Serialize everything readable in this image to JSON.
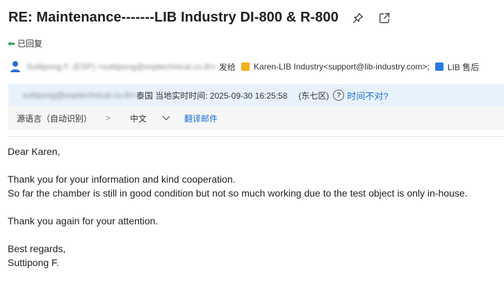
{
  "header": {
    "subject": "RE: Maintenance-------LIB Industry DI-800 & R-800",
    "pin_icon": "pin-icon",
    "popout_icon": "external-open-icon"
  },
  "status": {
    "replied": "已回复"
  },
  "from": {
    "sender_blurred": "Suttipong F. (ESP) <suttipong@esptechnical.co.th>",
    "sent_to_label": "发给",
    "recipient1": "Karen-LIB Industry<support@lib-industry.com>;",
    "recipient2": "LIB 售后"
  },
  "info_bar": {
    "location_blurred": "suttipong@esptechnical.co.th>",
    "location_text": "泰国 当地实时时间: 2025-09-30 16:25:58",
    "timezone": "(东七区)",
    "wrong_time_link": "时间不对?"
  },
  "translate": {
    "source_lang": "源语言（自动识别）",
    "arrow": ">",
    "target_lang": "中文",
    "translate_link": "翻译邮件"
  },
  "body": {
    "greeting": "Dear Karen,",
    "line1": "Thank you for your information and kind cooperation.",
    "line2": "So far the chamber is still in good condition but not so much working due to the test object is only in-house.",
    "line3": "Thank you again for your attention.",
    "closing": "Best regards,",
    "signature": "Suttipong F."
  },
  "colors": {
    "link": "#1a6fd6",
    "info_bar_bg": "#e8f2fd",
    "replied_arrow": "#2e9e4a"
  }
}
